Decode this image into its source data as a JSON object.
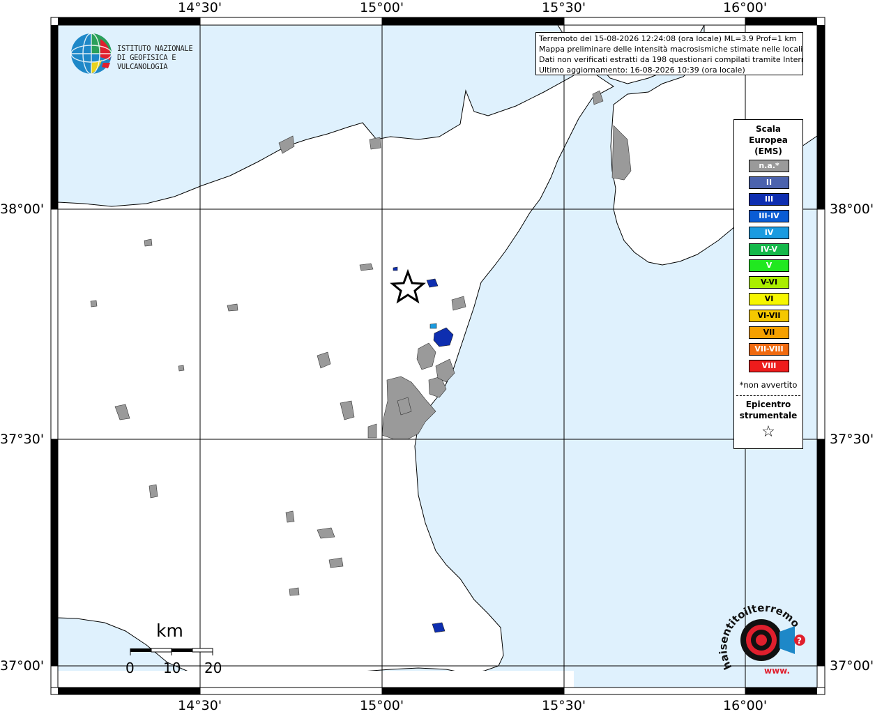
{
  "map": {
    "lon_labels": [
      "14°30'",
      "15°00'",
      "15°30'",
      "16°00'"
    ],
    "lat_labels": [
      "38°00'",
      "37°30'",
      "37°00'"
    ],
    "colors": {
      "sea": "#dff1fd",
      "land": "#ffffff",
      "urban": "#9a9a9a",
      "grid": "#000000"
    }
  },
  "info": {
    "line1": "Terremoto del 15-08-2026 12:24:08 (ora locale) ML=3.9 Prof=1 km",
    "line2": "Mappa preliminare delle intensità macrosismiche stimate nelle località",
    "line3": "Dati non verificati estratti da 198 questionari compilati tramite Internet.",
    "line4": "Ultimo aggiornamento: 16-08-2026 10:39 (ora locale)"
  },
  "legend": {
    "title_line1": "Scala",
    "title_line2": "Europea",
    "title_line3": "(EMS)",
    "items": [
      {
        "label": "n.a.*",
        "color": "#9a9a9a"
      },
      {
        "label": "II",
        "color": "#4b62ad"
      },
      {
        "label": "III",
        "color": "#0e2eb0"
      },
      {
        "label": "III-IV",
        "color": "#0a5cd4"
      },
      {
        "label": "IV",
        "color": "#1a9be0"
      },
      {
        "label": "IV-V",
        "color": "#14b84a"
      },
      {
        "label": "V",
        "color": "#21e820"
      },
      {
        "label": "V-VI",
        "color": "#aaee00"
      },
      {
        "label": "VI",
        "color": "#f6f600"
      },
      {
        "label": "VI-VII",
        "color": "#f5c800"
      },
      {
        "label": "VII",
        "color": "#f5a000"
      },
      {
        "label": "VII-VIII",
        "color": "#f06a10"
      },
      {
        "label": "VIII",
        "color": "#ee1c1c"
      }
    ],
    "note": "*non avvertito",
    "epicentre_line1": "Epicentro",
    "epicentre_line2": "strumentale",
    "epicentre_symbol": "☆"
  },
  "ingv": {
    "line1": "ISTITUTO NAZIONALE",
    "line2": "DI GEOFISICA E VULCANOLOGIA"
  },
  "scale": {
    "unit": "km",
    "ticks": [
      "0",
      "10",
      "20"
    ]
  },
  "haisentito": {
    "text": "haisentitoilterremoto.it",
    "url": "www.",
    "question": "?"
  }
}
